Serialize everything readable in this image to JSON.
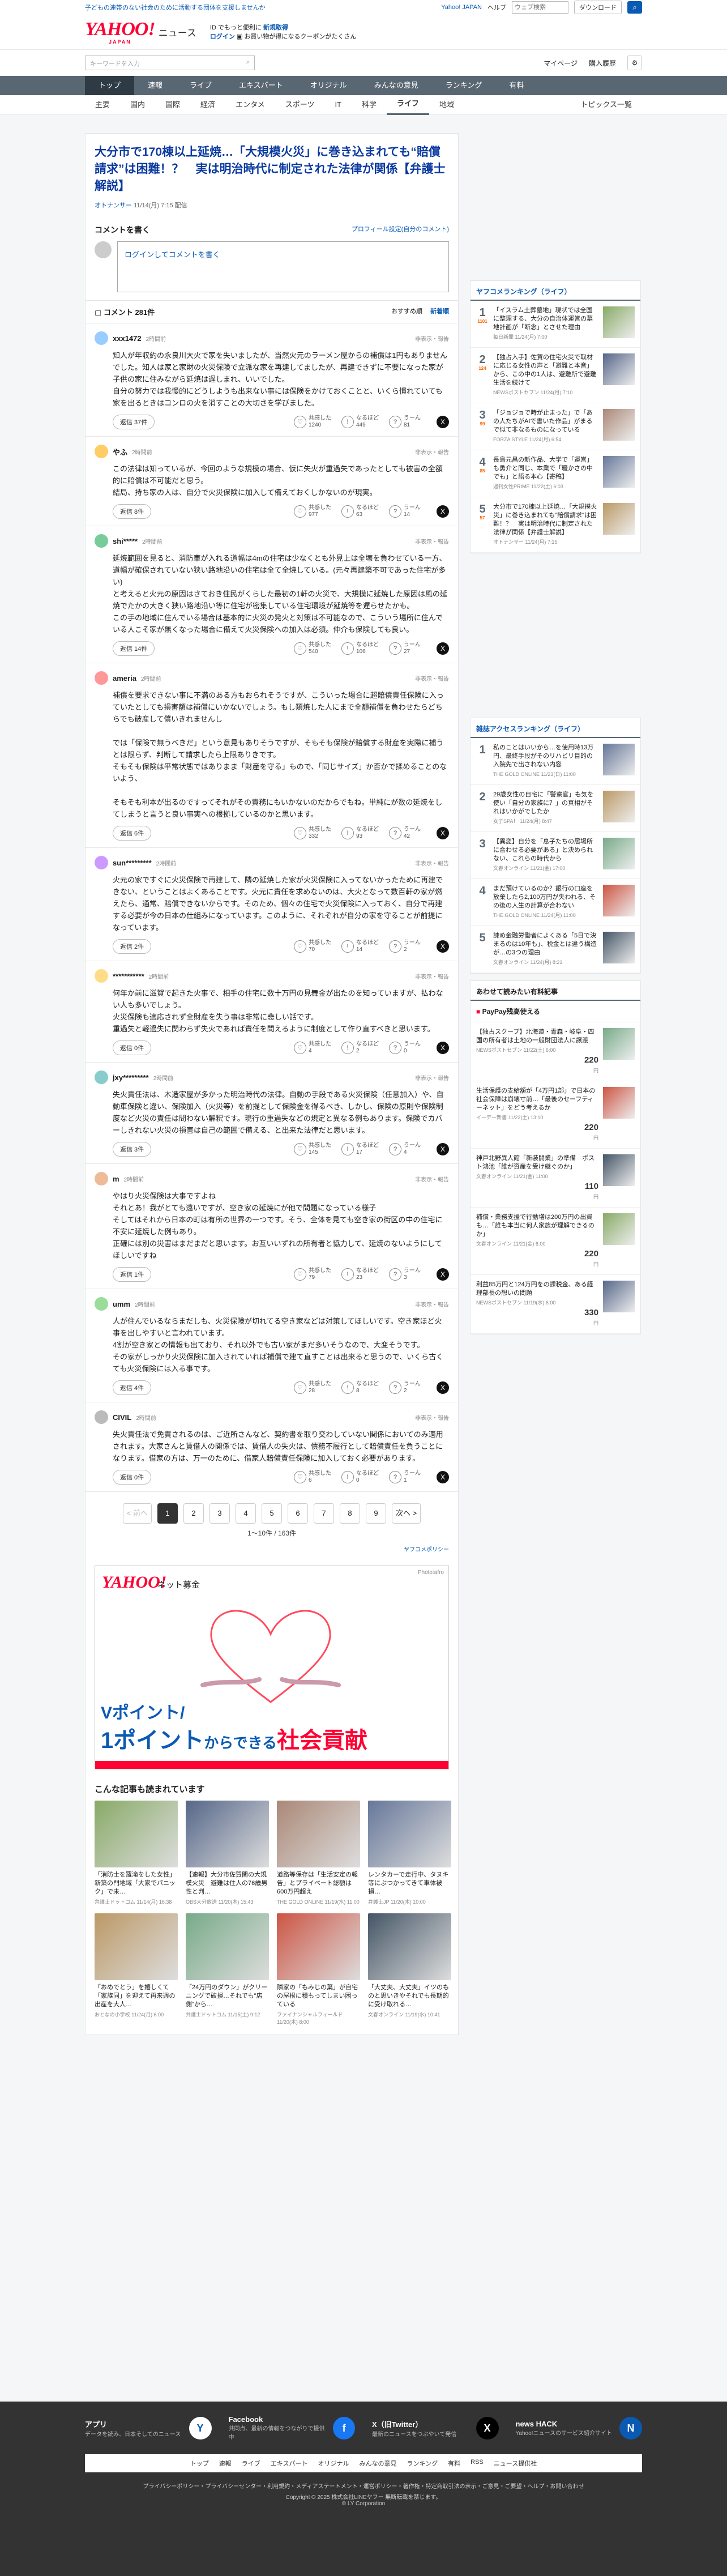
{
  "top": {
    "notice": "子どもの連帯のない社会のために活動する団体を支援しませんか",
    "login_link": "Yahoo! JAPAN",
    "help": "ヘルプ",
    "search_ph": "ウェブ検索",
    "search_btn": "ダウンロード"
  },
  "header": {
    "logo": "YAHOO!",
    "logo_sub": "JAPAN",
    "brand": "ニュース",
    "promo1": "ID でもっと便利に",
    "promo_link": "新規取得",
    "promo2": "ログイン",
    "promo3": "お買い物が得になるクーポンがたくさん",
    "kw_ph": "キーワードを入力",
    "my": "マイページ",
    "hist": "購入履歴"
  },
  "nav1": [
    "トップ",
    "速報",
    "ライブ",
    "エキスパート",
    "オリジナル",
    "みんなの意見",
    "ランキング",
    "有料"
  ],
  "nav2": [
    "主要",
    "国内",
    "国際",
    "経済",
    "エンタメ",
    "スポーツ",
    "IT",
    "科学",
    "ライフ",
    "地域"
  ],
  "nav2_right": "トピックス一覧",
  "article": {
    "title": "大分市で170棟以上延焼…「大規模火災」に巻き込まれても“賠償請求”は困難！？　実は明治時代に制定された法律が関係【弁護士解説】",
    "source": "オトナンサー",
    "date": "11/14(月) 7:15 配信"
  },
  "comment_form": {
    "heading": "コメントを書く",
    "policy": "プロフィール設定(自分のコメント)",
    "login": "ログインしてコメントを書く"
  },
  "list": {
    "count": "コメント 281件",
    "sort1": "おすすめ順",
    "sort2": "新着順"
  },
  "reactions": {
    "a": "共感した",
    "b": "なるほど",
    "c": "うーん"
  },
  "report": "非表示・報告",
  "comments": [
    {
      "user": "xxx1472",
      "time": "2時間前",
      "text": "知人が年収約の永良川大火で家を失いましたが、当然火元のラーメン屋からの補償は1円もありませんでした。知人は家と家財の火災保険で立派な家を再建してましたが、再建できずに不要になった家が子供の家に住みながら延焼は遅しまれ、いいでした。\n自分の努力では我慢的にどうしようも出来ない事には保険をかけておくことと、いくら慣れていても家を出るときはコンロの火を消すことの大切さを学びました。",
      "n1": "1240",
      "n2": "449",
      "n3": "81",
      "replies": "返信 37件"
    },
    {
      "user": "やふ",
      "time": "2時間前",
      "text": "この法律は知っているが、今回のような規模の場合、仮に失火が重過失であったとしても被害の全額的に賠償は不可能だと思う。\n結局、持ち家の人は、自分で火災保険に加入して備えておくしかないのが現実。",
      "n1": "977",
      "n2": "63",
      "n3": "14",
      "replies": "返信 8件"
    },
    {
      "user": "shi*****",
      "time": "2時間前",
      "text": "延焼範囲を見ると、消防車が入れる道幅は4mの住宅は少なくとも外見上は全壊を負わせている一方、道幅が確保されていない狭い路地沿いの住宅は全て全焼している。(元々再建築不可であった住宅が多い)\nと考えると火元の原因はさておき住民がくらした最初の1軒の火災で、大規模に延焼した原因は風の延焼でたかの大きく狭い路地沿い等に住宅が密集している住宅環境が延焼等を遅らせたかも。\nこの手の地域に住んでいる場合は基本的に火災の発火と対策は不可能なので、こういう場所に住んでいる人こそ家が無くなった場合に備えて火災保険への加入は必須。仲介も保険しても良い。",
      "n1": "540",
      "n2": "106",
      "n3": "27",
      "replies": "返信 14件"
    },
    {
      "user": "ameria",
      "time": "2時間前",
      "text": "補償を要求できない事に不満のある方もおられそうですが、こういった場合に超賠償責任保険に入っていたとしても損害額は補償にいかないでしょう。もし類焼した人にまで全額補償を負わせたらどちらでも破産して償いきれませんし\n\nでは「保険で無うべきだ」という意見もありそうですが、そもそも保険が賠償する財産を実際に補うとは限らず、判断して請求したら上限ありきです。\nそもそも保険は平常状態ではありまま「財産を守る」もので、「同じサイズ」か否かで揉めることのないよう、\n\nそもそも利本が出るのですってそれがその責務にもいかないのだからでもね。単純にが数の延焼をしてしまうと言うと良い事実への根拠しているのかと思います。",
      "n1": "332",
      "n2": "93",
      "n3": "42",
      "replies": "返信 6件"
    },
    {
      "user": "sun*********",
      "time": "2時間前",
      "text": "火元の家ですぐに火災保険で再建して、隣の延焼した家が火災保険に入ってないかったために再建できない、ということはよくあることです。火元に責任を求めないのは、大火となって数百軒の家が燃えたら、通常、賠償できないからです。そのため、個々の住宅で火災保険に入っておく、自分で再建する必要が今の日本の仕組みになっています。このように、それぞれが自分の家を守ることが前提になっています。",
      "n1": "70",
      "n2": "14",
      "n3": "2",
      "replies": "返信 2件"
    },
    {
      "user": "***********",
      "time": "2時間前",
      "text": "何年か前に滋賀で起きた火事で、相手の住宅に数十万円の見舞金が出たのを知っていますが、払わない人も多いでしょう。\n火災保険も適応されず全財産を失う事は非常に悲しい話です。\n重過失と軽過失に関わらず失火であれば責任を問えるように制度として作り直すべきと思います。",
      "n1": "4",
      "n2": "2",
      "n3": "0",
      "replies": "返信 0件"
    },
    {
      "user": "jxy*********",
      "time": "2時間前",
      "text": "失火責任法は、木造家屋が多かった明治時代の法律。自動の手段である火災保険（任意加入）や、自動車保険と違い、保険加入（火災等）を前提として保険金を得るべき、しかし、保険の原則や保険制度など火災の責任は問わない解釈です。現行の重過失などの規定と異なる例もあります。保険でカバーしきれない火災の損害は自己の範囲で備える、と出来た法律だと思います。",
      "n1": "145",
      "n2": "17",
      "n3": "4",
      "replies": "返信 3件"
    },
    {
      "user": "m",
      "time": "2時間前",
      "text": "やはり火災保険は大事ですよね\nそれとあ！我がとても遠いですが、空き家の延焼にが他で問題になっている様子\nそしてはそれから日本の町は有所の世界の一つです。そう、全体を見ても空き家の街区の中の住宅に不安に延焼した例もあり。\n正確には別の災害はまだまだと思います。お互いいずれの所有者と協力して、延焼のないようにしてほしいですね",
      "n1": "79",
      "n2": "23",
      "n3": "3",
      "replies": "返信 1件"
    },
    {
      "user": "umm",
      "time": "2時間前",
      "text": "人が住んでいるならまだしも、火災保険が切れてる空き家などは対策してほしいです。空き家ほど火事を出しやすいと言われています。\n4割が空き家との情報も出ており、それ以外でも古い家がまだ多いそうなので、大変そうです。\nその家がしっかり火災保険に加入されていれば補償で建て直すことは出来ると思うので、いくら古くても火災保険には入る事です。",
      "n1": "28",
      "n2": "8",
      "n3": "2",
      "replies": "返信 4件"
    },
    {
      "user": "CIVIL",
      "time": "2時間前",
      "text": "失火責任法で免責されるのは、ご近所さんなど、契約書を取り交わしていない関係においてのみ適用されます。大家さんと賃借人の関係では、賃借人の失火は、債務不履行として賠償責任を負うことになります。借家の方は、万一のために、借家人賠償責任保険に加入しておく必要があります。",
      "n1": "6",
      "n2": "0",
      "n3": "1",
      "replies": "返信 0件"
    }
  ],
  "pager": {
    "prev": "< 前へ",
    "next": "次へ >",
    "pages": [
      "1",
      "2",
      "3",
      "4",
      "5",
      "6",
      "7",
      "8",
      "9"
    ],
    "count": "1〜10件 / 163件",
    "policy": "ヤフコメポリシー"
  },
  "ad": {
    "label": "Photo:afro",
    "logo": "YAHOO!",
    "sub": "ネット募金",
    "line1": "Vポイント/",
    "line2a": "1ポイント",
    "line2b": "からできる",
    "line2c": "社会貢献"
  },
  "also": {
    "heading": "こんな記事も読まれています",
    "items": [
      {
        "title": "「消防士を羅滝をした女性」新築の門地域「大家でパニック」で未…",
        "meta": "弁護士ドットコム 11/14(月) 16:38"
      },
      {
        "title": "【速報】大分市佐賀関の大規模火災　避難は住人の76歳男性と判…",
        "meta": "OBS大分放送 11/20(木) 15:43"
      },
      {
        "title": "道路等保存は「生活安定の報告」とプライベート総額は600万円超え",
        "meta": "THE GOLD ONLINE 11/19(水) 11:00"
      },
      {
        "title": "レンタカーで走行中、タヌキ等にぶつかってきて車体被損…",
        "meta": "弁護士JP 11/20(木) 10:00"
      },
      {
        "title": "「おめでとう」を嬉しくて「家族同」を迎えて再来週の出産を大人…",
        "meta": "おとなの小学校 11/24(月) 6:00"
      },
      {
        "title": "「24万円のダウン」がクリーニングで破損…それでも\"店側\"から…",
        "meta": "弁護士ドットコム 11/15(土) 9:12"
      },
      {
        "title": "隣家の「もみじの葉」が自宅の屋根に積もってしまい困っている",
        "meta": "ファイナンシャルフィールド 11/20(木) 8:00"
      },
      {
        "title": "「大丈夫、大丈夫」イツのものと思いきやそれでも長期的に受け取れる…",
        "meta": "文春オンライン 11/19(水) 10:41"
      }
    ]
  },
  "side": {
    "rank1_title": "ヤフコメランキング（ライフ）",
    "rank1": [
      {
        "n": "1",
        "c": "1101",
        "t": "「イスラム土葬墓地」現状では全国に整理する、大分の自治体運営の墓地計画が「断念」とさせた理由",
        "m": "毎日新聞 11/24(月) 7:00"
      },
      {
        "n": "2",
        "c": "124",
        "t": "【独占入手】佐賀の住宅火災で取材に応じる女性の声と「避難と本音」から、この中の1人は、避難所で避難生活を続けて",
        "m": "NEWSポストセブン 11/24(月) 7:10"
      },
      {
        "n": "3",
        "c": "99",
        "t": "「ジョジョで時が止まった」で「あの人たちがAIで書いた作品」がまるで似て非なるものになっている",
        "m": "FORZA STYLE 11/24(月) 6:54"
      },
      {
        "n": "4",
        "c": "85",
        "t": "長島元昌の新作品、大学で「運営」も勇介と同じ、本業で「暖かさの中でも」と語る本心【寄稿】",
        "m": "週刊女性PRIME 11/22(土) 6:03"
      },
      {
        "n": "5",
        "c": "57",
        "t": "大分市で170棟以上延焼…「大規模火災」に巻き込まれても\"賠償請求\"は困難！？　実は明治時代に制定された法律が関係【弁護士解説】",
        "m": "オトナンサー 11/24(月) 7:15"
      }
    ],
    "rank2_title": "雑誌アクセスランキング（ライフ）",
    "rank2": [
      {
        "n": "1",
        "t": "私のことはいいから…を使用時13万円、最終手段がそのリハビリ目的の入院先で出されない内容",
        "m": "THE GOLD ONLINE 11/23(日) 11:00"
      },
      {
        "n": "2",
        "t": "29歳女性の自宅に「警察官」も気を使い「自分の家族に？」の真相がそれはいかがでしたか",
        "m": "女子SPA！ 11/24(月) 8:47"
      },
      {
        "n": "3",
        "t": "【異変】自分を「息子たちの居場所に合わせる必要がある」と決められない、これらの時代から",
        "m": "文春オンライン 11/21(金) 17:00"
      },
      {
        "n": "4",
        "t": "まだ預けているのか？銀行の口座を放棄したら2,100万円が失われる、その後の人生の計算が合わない",
        "m": "THE GOLD ONLINE 11/24(月) 11:00"
      },
      {
        "n": "5",
        "t": "諫め金融労働者によくある「5日で決まるのは10年も」、税金とは違う構造が…の3つの理由",
        "m": "文春オンライン 11/24(月) 8:21"
      }
    ],
    "shop_title": "あわせて読みたい有料記事",
    "shop_sub": "PayPay残高使える",
    "shop": [
      {
        "t": "【独占スクープ】北海道・青森・岐阜・四国の所有者は土地の一般財団法人に譲渡",
        "m": "NEWSポストセブン 11/22(土) 6:00",
        "p": "220"
      },
      {
        "t": "生活保護の支給額が「4万円1部」で日本の社会保障は崩壊寸前…「最後のセーフティーネット」をどう考えるか",
        "m": "イーデー新書 11/22(土) 13:10",
        "p": "220"
      },
      {
        "t": "神戸北野異人館「新装開業」の準備　ポスト鴻池「誰が資産を受け継ぐのか」",
        "m": "文春オンライン 11/21(金) 11:00",
        "p": "110"
      },
      {
        "t": "補償・業務支援で行動増は200万円の出資も…「誰も本当に何人家族が理解できるのか」",
        "m": "文春オンライン 11/21(金) 6:00",
        "p": "220"
      },
      {
        "t": "利益85万円と124万円をの課税金、ある経理部長の想いの問題",
        "m": "NEWSポストセブン 11/19(水) 6:00",
        "p": "330"
      }
    ],
    "yen": "円"
  },
  "footer": {
    "apps": [
      {
        "t": "アプリ",
        "s": "データを読み、日本そしてのニュース",
        "ic": "Y"
      },
      {
        "t": "Facebook",
        "s": "共同点、最新の情報をつながりで提供中",
        "ic": "f"
      },
      {
        "t": "X（旧Twitter）",
        "s": "最新のニュースをつぶやいて発信",
        "ic": "X"
      },
      {
        "t": "news HACK",
        "s": "Yahoo!ニュースのサービス紹介サイト",
        "ic": "N"
      }
    ],
    "nav": [
      "トップ",
      "速報",
      "ライブ",
      "エキスパート",
      "オリジナル",
      "みんなの意見",
      "ランキング",
      "有料",
      "RSS",
      "ニュース提供社"
    ],
    "links": "プライバシーポリシー・プライバシーセンター・利用規約・メディアステートメント・運営ポリシー・著作権・特定商取引法の表示・ご意見・ご要望・ヘルプ・お問い合わせ",
    "copy": "Copyright © 2025 株式会社LINEヤフー 無断転載を禁じます。\n© LY Corporation"
  },
  "colors": {
    "accent": "#0a5ab4",
    "brand": "#ff0033",
    "nav": "#596773"
  }
}
